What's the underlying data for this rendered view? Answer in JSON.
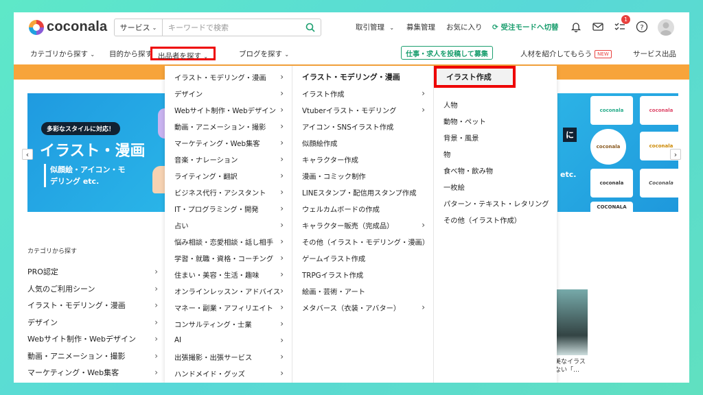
{
  "header": {
    "logo_text": "coconala",
    "search": {
      "category": "サービス",
      "placeholder": "キーワードで検索"
    },
    "nav": {
      "transactions": "取引管理",
      "recruit_mgmt": "募集管理",
      "favorites": "お気に入り",
      "mode_switch": "受注モードへ切替"
    },
    "notification_count": "1"
  },
  "nav2": {
    "items": [
      "カテゴリから探す",
      "目的から探す",
      "出品者を探す",
      "ブログを探す"
    ],
    "post_button": "仕事・求人を投稿して募集",
    "introduce": "人材を紹介してもらう",
    "new_badge": "NEW",
    "sell": "サービス出品"
  },
  "banner": {
    "tag": "多彩なスタイルに対応！",
    "title": "イラスト・漫画",
    "sub": "似顔絵・アイコン・モデリング etc.",
    "right_frag": "に",
    "right_etc": "etc."
  },
  "tiles": [
    "coconala",
    "coconala",
    "coconala",
    "coconala",
    "coconala",
    "Coconala",
    "COCONALA"
  ],
  "sidebar": {
    "title": "カテゴリから探す",
    "items": [
      "PRO認定",
      "人気のご利用シーン",
      "イラスト・モデリング・漫画",
      "デザイン",
      "Webサイト制作・Webデザイン",
      "動画・アニメーション・撮影",
      "マーケティング・Web集客"
    ]
  },
  "photo_caption": [
    "美なイラス",
    "ない「…"
  ],
  "dropdown": {
    "col1": [
      "イラスト・モデリング・漫画",
      "デザイン",
      "Webサイト制作・Webデザイン",
      "動画・アニメーション・撮影",
      "マーケティング・Web集客",
      "音楽・ナレーション",
      "ライティング・翻訳",
      "ビジネス代行・アシスタント",
      "IT・プログラミング・開発",
      "占い",
      "悩み相談・恋愛相談・話し相手",
      "学習・就職・資格・コーチング",
      "住まい・美容・生活・趣味",
      "オンラインレッスン・アドバイス",
      "マネー・副業・アフィリエイト",
      "コンサルティング・士業",
      "AI",
      "出張撮影・出張サービス",
      "ハンドメイド・グッズ"
    ],
    "col2_head": "イラスト・モデリング・漫画",
    "col2": [
      "イラスト作成",
      "Vtuberイラスト・モデリング",
      "アイコン・SNSイラスト作成",
      "似顔絵作成",
      "キャラクター作成",
      "漫画・コミック制作",
      "LINEスタンプ・配信用スタンプ作成",
      "ウェルカムボードの作成",
      "キャラクター販売（完成品）",
      "その他（イラスト・モデリング・漫画）",
      "ゲームイラスト作成",
      "TRPGイラスト作成",
      "絵画・芸術・アート",
      "メタバース（衣装・アバター）"
    ],
    "col2_chev": [
      true,
      true,
      false,
      false,
      false,
      false,
      false,
      false,
      true,
      false,
      false,
      false,
      false,
      true
    ],
    "col3_head": "イラスト作成",
    "col3": [
      "人物",
      "動物・ペット",
      "背景・風景",
      "物",
      "食べ物・飲み物",
      "一枚絵",
      "パターン・テキスト・レタリング",
      "その他（イラスト作成）"
    ]
  },
  "colors": {
    "brand_green": "#1a9e6e",
    "orange": "#f7a43b",
    "highlight_red": "#e00000"
  }
}
